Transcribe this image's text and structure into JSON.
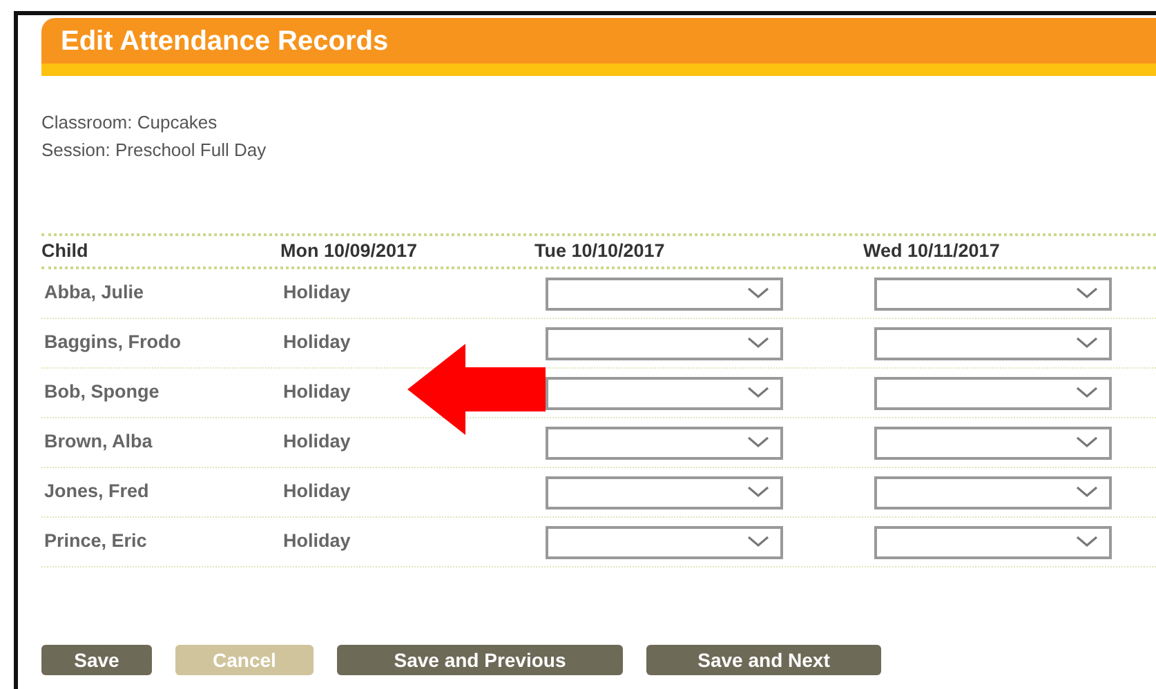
{
  "title": "Edit Attendance Records",
  "info": [
    "Classroom: Cupcakes",
    "Session: Preschool Full Day"
  ],
  "table": {
    "columns": [
      "Child",
      "Mon 10/09/2017",
      "Tue 10/10/2017",
      "Wed 10/11/2017"
    ],
    "rows": [
      {
        "child": "Abba, Julie",
        "mon": "Holiday"
      },
      {
        "child": "Baggins, Frodo",
        "mon": "Holiday"
      },
      {
        "child": "Bob, Sponge",
        "mon": "Holiday"
      },
      {
        "child": "Brown, Alba",
        "mon": "Holiday"
      },
      {
        "child": "Jones, Fred",
        "mon": "Holiday"
      },
      {
        "child": "Prince, Eric",
        "mon": "Holiday"
      }
    ]
  },
  "buttons": [
    {
      "label": "Save",
      "kind": "primary"
    },
    {
      "label": "Cancel",
      "kind": "secondary"
    },
    {
      "label": "Save and Previous",
      "kind": "primary"
    },
    {
      "label": "Save and Next",
      "kind": "primary"
    }
  ]
}
